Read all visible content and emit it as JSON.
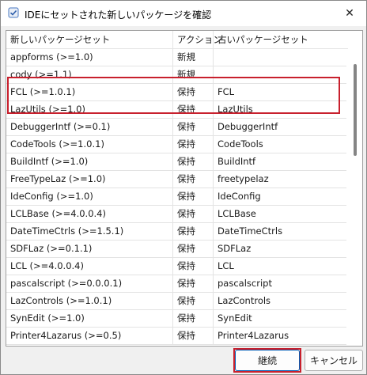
{
  "window": {
    "title": "IDEにセットされた新しいパッケージを確認",
    "close_glyph": "✕"
  },
  "columns": {
    "new_set": "新しいパッケージセット",
    "action": "アクション",
    "old_set": "古いパッケージセット"
  },
  "rows": [
    {
      "new": "appforms (>=1.0)",
      "action": "新規",
      "old": ""
    },
    {
      "new": "cody (>=1.1)",
      "action": "新規",
      "old": ""
    },
    {
      "new": "FCL (>=1.0.1)",
      "action": "保持",
      "old": "FCL"
    },
    {
      "new": "LazUtils (>=1.0)",
      "action": "保持",
      "old": "LazUtils"
    },
    {
      "new": "DebuggerIntf (>=0.1)",
      "action": "保持",
      "old": "DebuggerIntf"
    },
    {
      "new": "CodeTools (>=1.0.1)",
      "action": "保持",
      "old": "CodeTools"
    },
    {
      "new": "BuildIntf (>=1.0)",
      "action": "保持",
      "old": "BuildIntf"
    },
    {
      "new": "FreeTypeLaz (>=1.0)",
      "action": "保持",
      "old": "freetypelaz"
    },
    {
      "new": "IdeConfig (>=1.0)",
      "action": "保持",
      "old": "IdeConfig"
    },
    {
      "new": "LCLBase (>=4.0.0.4)",
      "action": "保持",
      "old": "LCLBase"
    },
    {
      "new": "DateTimeCtrls (>=1.5.1)",
      "action": "保持",
      "old": "DateTimeCtrls"
    },
    {
      "new": "SDFLaz (>=0.1.1)",
      "action": "保持",
      "old": "SDFLaz"
    },
    {
      "new": "LCL (>=4.0.0.4)",
      "action": "保持",
      "old": "LCL"
    },
    {
      "new": "pascalscript (>=0.0.0.1)",
      "action": "保持",
      "old": "pascalscript"
    },
    {
      "new": "LazControls (>=1.0.1)",
      "action": "保持",
      "old": "LazControls"
    },
    {
      "new": "SynEdit (>=1.0)",
      "action": "保持",
      "old": "SynEdit"
    },
    {
      "new": "Printer4Lazarus (>=0.5)",
      "action": "保持",
      "old": "Printer4Lazarus"
    }
  ],
  "buttons": {
    "continue": "継続",
    "cancel": "キャンセル"
  },
  "colors": {
    "highlight": "#c8202d",
    "accent": "#005fb8"
  },
  "icons": {
    "app": "package-check-icon",
    "close": "close-icon"
  }
}
